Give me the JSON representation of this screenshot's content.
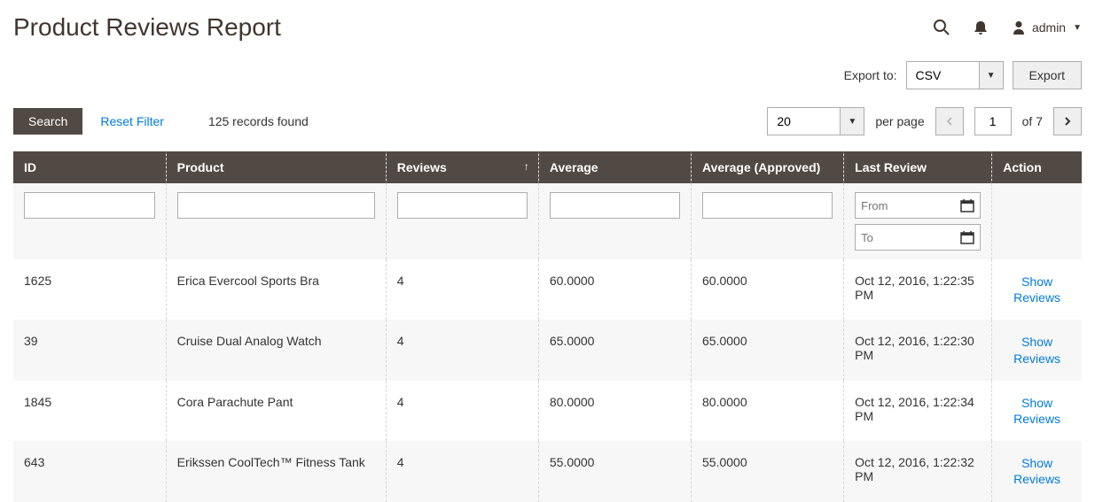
{
  "header": {
    "title": "Product Reviews Report",
    "admin_label": "admin"
  },
  "export": {
    "label": "Export to:",
    "format": "CSV",
    "button": "Export"
  },
  "toolbar": {
    "search": "Search",
    "reset": "Reset Filter",
    "records_found": "125 records found",
    "per_page_value": "20",
    "per_page_label": "per page",
    "page_value": "1",
    "of_pages": "of 7"
  },
  "columns": {
    "id": "ID",
    "product": "Product",
    "reviews": "Reviews",
    "average": "Average",
    "avg_approved": "Average (Approved)",
    "last_review": "Last Review",
    "action": "Action"
  },
  "filters": {
    "from_ph": "From",
    "to_ph": "To"
  },
  "rows": [
    {
      "id": "1625",
      "product": "Erica Evercool Sports Bra",
      "reviews": "4",
      "average": "60.0000",
      "avg_approved": "60.0000",
      "last": "Oct 12, 2016, 1:22:35 PM",
      "action": "Show Reviews"
    },
    {
      "id": "39",
      "product": "Cruise Dual Analog Watch",
      "reviews": "4",
      "average": "65.0000",
      "avg_approved": "65.0000",
      "last": "Oct 12, 2016, 1:22:30 PM",
      "action": "Show Reviews"
    },
    {
      "id": "1845",
      "product": "Cora Parachute Pant",
      "reviews": "4",
      "average": "80.0000",
      "avg_approved": "80.0000",
      "last": "Oct 12, 2016, 1:22:34 PM",
      "action": "Show Reviews"
    },
    {
      "id": "643",
      "product": "Erikssen CoolTech™ Fitness Tank",
      "reviews": "4",
      "average": "55.0000",
      "avg_approved": "55.0000",
      "last": "Oct 12, 2016, 1:22:32 PM",
      "action": "Show Reviews"
    }
  ]
}
